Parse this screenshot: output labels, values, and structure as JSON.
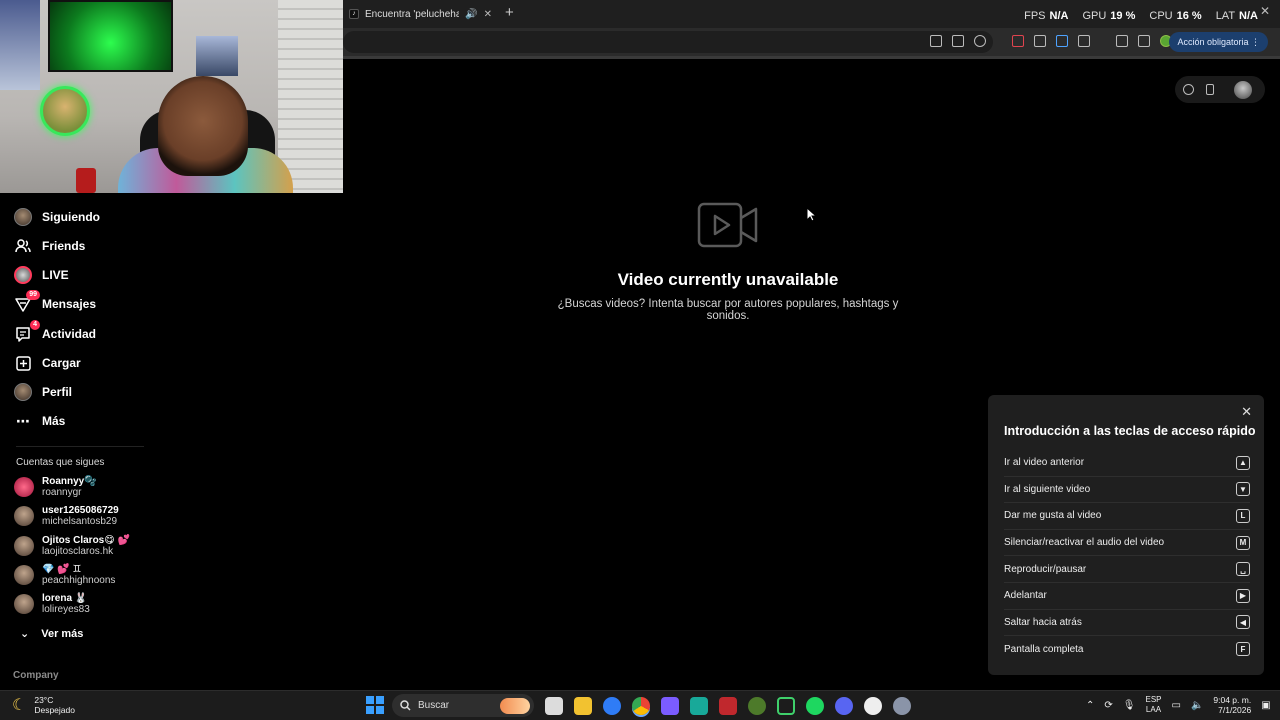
{
  "browser": {
    "tab_title": "Encuentra 'pelucheharden'",
    "tab_favicon": "♪",
    "action_button": "Acción obligatoria ⋮"
  },
  "perf": {
    "fps_label": "FPS",
    "fps_value": "N/A",
    "gpu_label": "GPU",
    "gpu_value": "19 %",
    "cpu_label": "CPU",
    "cpu_value": "16 %",
    "lat_label": "LAT",
    "lat_value": "N/A"
  },
  "sidebar": {
    "items": [
      {
        "label": "Siguiendo",
        "icon": "avatar"
      },
      {
        "label": "Friends",
        "icon": "friends-icon"
      },
      {
        "label": "LIVE",
        "icon": "live-icon"
      },
      {
        "label": "Mensajes",
        "icon": "messages-icon",
        "badge": "99"
      },
      {
        "label": "Actividad",
        "icon": "activity-icon",
        "badge": "4"
      },
      {
        "label": "Cargar",
        "icon": "upload-icon"
      },
      {
        "label": "Perfil",
        "icon": "profile-avatar"
      },
      {
        "label": "Más",
        "icon": "more-icon"
      }
    ],
    "following_heading": "Cuentas que sigues",
    "accounts": [
      {
        "name": "Roannyy🫧",
        "user": "roannygr"
      },
      {
        "name": "user1265086729",
        "user": "michelsantosb29"
      },
      {
        "name": "Ojitos Claros😋 💕",
        "user": "laojitosclaros.hk"
      },
      {
        "name": "💎 💕 ♊",
        "user": "peachhighnoons"
      },
      {
        "name": "lorena 🐰",
        "user": "lolireyes83"
      }
    ],
    "see_more": "Ver más",
    "company": "Company"
  },
  "main": {
    "unavailable_title": "Video currently unavailable",
    "unavailable_subtitle": "¿Buscas videos? Intenta buscar por autores populares, hashtags y sonidos."
  },
  "shortcuts": {
    "title": "Introducción a las teclas de acceso rápido",
    "rows": [
      {
        "label": "Ir al video anterior",
        "key": "▲"
      },
      {
        "label": "Ir al siguiente video",
        "key": "▼"
      },
      {
        "label": "Dar me gusta al video",
        "key": "L"
      },
      {
        "label": "Silenciar/reactivar el audio del video",
        "key": "M"
      },
      {
        "label": "Reproducir/pausar",
        "key": "␣"
      },
      {
        "label": "Adelantar",
        "key": "▶"
      },
      {
        "label": "Saltar hacia atrás",
        "key": "◀"
      },
      {
        "label": "Pantalla completa",
        "key": "F"
      }
    ]
  },
  "taskbar": {
    "temperature": "23°C",
    "weather": "Despejado",
    "search_placeholder": "Buscar",
    "lang_top": "ESP",
    "lang_bottom": "LAA",
    "time": "9:04 p. m.",
    "date": "7/1/2026"
  },
  "colors": {
    "accent_pink": "#fe2c55",
    "panel_bg": "#1f1f1f",
    "page_bg": "#000000"
  }
}
